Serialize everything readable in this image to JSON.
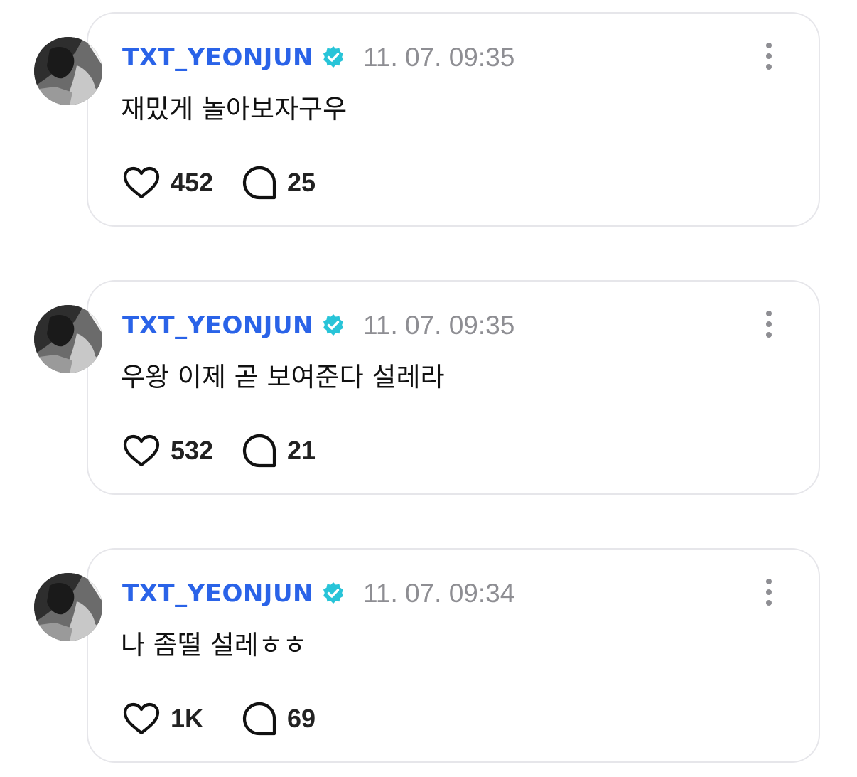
{
  "colors": {
    "username": "#2a63e8",
    "verified_badge": "#28c4d8",
    "timestamp": "#8e8e93",
    "card_border": "#e6e6ea",
    "text": "#111111"
  },
  "posts": [
    {
      "username": "TXT_YEONJUN",
      "verified_icon": "verified-badge-icon",
      "timestamp": "11. 07. 09:35",
      "text": "재밌게 놀아보자구우",
      "likes": "452",
      "comments": "25"
    },
    {
      "username": "TXT_YEONJUN",
      "verified_icon": "verified-badge-icon",
      "timestamp": "11. 07. 09:35",
      "text": "우왕 이제 곧 보여준다 설레라",
      "likes": "532",
      "comments": "21"
    },
    {
      "username": "TXT_YEONJUN",
      "verified_icon": "verified-badge-icon",
      "timestamp": "11. 07. 09:34",
      "text": "나 좀떨 설레ㅎㅎ",
      "likes": "1K",
      "comments": "69"
    }
  ]
}
